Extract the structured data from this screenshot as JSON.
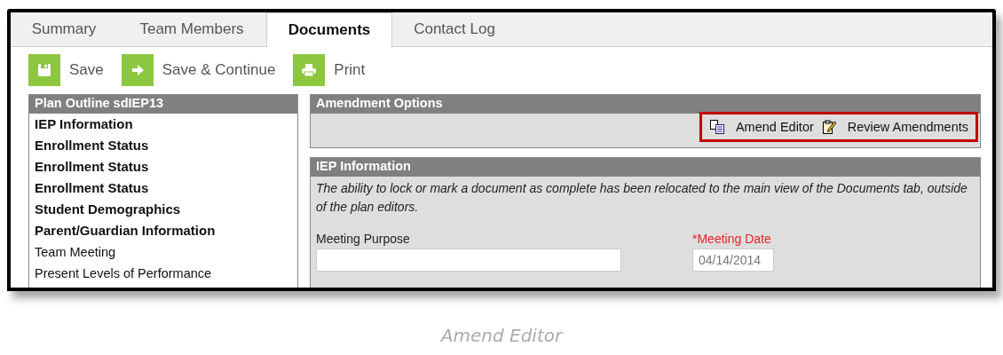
{
  "tabs": [
    {
      "label": "Summary",
      "selected": false
    },
    {
      "label": "Team Members",
      "selected": false
    },
    {
      "label": "Documents",
      "selected": true
    },
    {
      "label": "Contact Log",
      "selected": false
    }
  ],
  "toolbar": [
    {
      "kind": "save",
      "label": "Save"
    },
    {
      "kind": "continue",
      "label": "Save & Continue"
    },
    {
      "kind": "print",
      "label": "Print"
    }
  ],
  "outline": {
    "title": "Plan Outline sdIEP13",
    "items": [
      {
        "label": "IEP Information",
        "bold": true
      },
      {
        "label": "Enrollment Status",
        "bold": true
      },
      {
        "label": "Enrollment Status",
        "bold": true
      },
      {
        "label": "Enrollment Status",
        "bold": true
      },
      {
        "label": "Student Demographics",
        "bold": true
      },
      {
        "label": "Parent/Guardian Information",
        "bold": true
      },
      {
        "label": "Team Meeting",
        "bold": false
      },
      {
        "label": "Present Levels of Performance",
        "bold": false
      }
    ]
  },
  "amendment_options": {
    "title": "Amendment Options",
    "highlighted": true,
    "actions": [
      {
        "kind": "copy",
        "label": "Amend Editor"
      },
      {
        "kind": "edit",
        "label": "Review Amendments"
      }
    ]
  },
  "iep_information": {
    "title": "IEP Information",
    "note": "The ability to lock or mark a document as complete has been relocated to the main view of the Documents tab, outside of the plan editors.",
    "fields": [
      {
        "label": "Meeting Purpose",
        "required": false
      },
      {
        "label": "*Meeting Date",
        "required": true,
        "value": "04/14/2014"
      }
    ]
  },
  "caption": "Amend Editor"
}
